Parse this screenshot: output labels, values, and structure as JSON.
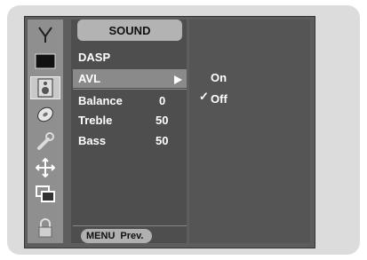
{
  "menu": {
    "title": "SOUND",
    "items": [
      {
        "label": "DASP",
        "value": ""
      },
      {
        "label": "AVL",
        "value": ""
      },
      {
        "label": "Balance",
        "value": "0"
      },
      {
        "label": "Treble",
        "value": "50"
      },
      {
        "label": "Bass",
        "value": "50"
      }
    ],
    "selected_index": 1
  },
  "submenu": {
    "options": [
      {
        "label": "On",
        "checked": false
      },
      {
        "label": "Off",
        "checked": true
      }
    ]
  },
  "footer": {
    "menu_key": "MENU",
    "action": "Prev."
  },
  "icons": [
    "antenna-icon",
    "picture-icon",
    "speaker-icon",
    "disc-icon",
    "wrench-icon",
    "move-arrows-icon",
    "pip-windows-icon",
    "lock-icon"
  ],
  "colors": {
    "highlight": "#8a8a8a",
    "title_box": "#b3b3b3"
  }
}
